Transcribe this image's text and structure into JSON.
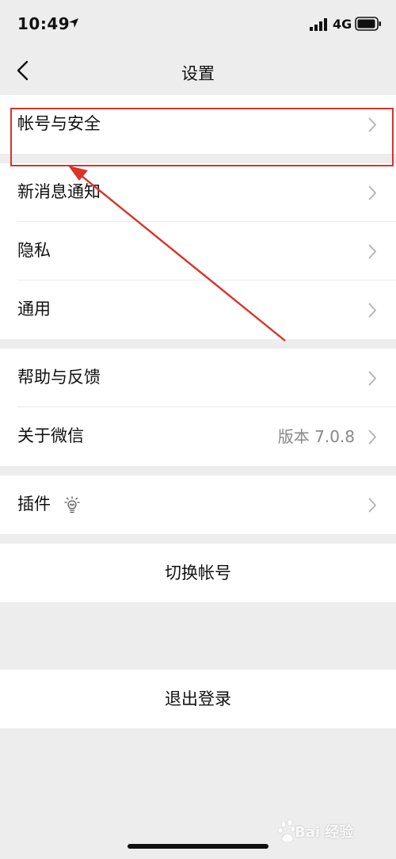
{
  "status_bar": {
    "time": "10:49",
    "network": "4G"
  },
  "nav": {
    "title": "设置"
  },
  "groups": {
    "account": {
      "label": "帐号与安全"
    },
    "general": [
      {
        "label": "新消息通知"
      },
      {
        "label": "隐私"
      },
      {
        "label": "通用"
      }
    ],
    "about": [
      {
        "label": "帮助与反馈"
      },
      {
        "label": "关于微信",
        "value": "版本 7.0.8"
      }
    ],
    "plugins": {
      "label": "插件"
    }
  },
  "actions": {
    "switch_account": "切换帐号",
    "logout": "退出登录"
  },
  "watermark": {
    "text": "Bai 经验"
  },
  "colors": {
    "annotation_red": "#d9332a",
    "background": "#ededed",
    "card": "#ffffff",
    "secondary_text": "#888888"
  }
}
